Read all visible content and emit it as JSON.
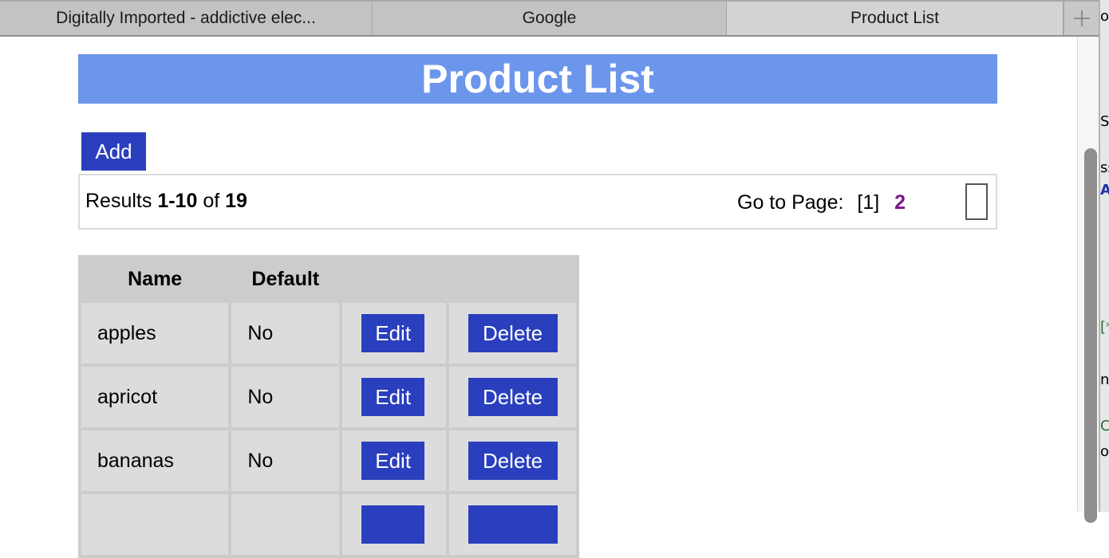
{
  "browser": {
    "tabs": [
      {
        "label": "Digitally Imported - addictive elec...",
        "active": false
      },
      {
        "label": "Google",
        "active": false
      },
      {
        "label": "Product List",
        "active": true
      }
    ],
    "new_tab_icon": "plus-icon"
  },
  "page": {
    "title": "Product List",
    "add_label": "Add",
    "results": {
      "prefix": "Results",
      "range": "1-10",
      "of_label": "of",
      "total": "19"
    },
    "pagination": {
      "label": "Go to Page:",
      "current": "[1]",
      "pages": [
        "2"
      ]
    },
    "table": {
      "headers": [
        "Name",
        "Default",
        "",
        ""
      ],
      "rows": [
        {
          "name": "apples",
          "default": "No",
          "edit_label": "Edit",
          "delete_label": "Delete"
        },
        {
          "name": "apricot",
          "default": "No",
          "edit_label": "Edit",
          "delete_label": "Delete"
        },
        {
          "name": "bananas",
          "default": "No",
          "edit_label": "Edit",
          "delete_label": "Delete"
        },
        {
          "name": "",
          "default": "",
          "edit_label": "",
          "delete_label": ""
        }
      ]
    }
  },
  "side_window_fragments": [
    "o",
    "Sp",
    "ss",
    "AA",
    "[*",
    "ne",
    "Co",
    "on"
  ],
  "colors": {
    "header_bg": "#6c95ec",
    "button_bg": "#2a3fbd",
    "visited_link": "#7b1788",
    "table_header_bg": "#cccccc",
    "table_cell_bg": "#dcdcdc"
  }
}
